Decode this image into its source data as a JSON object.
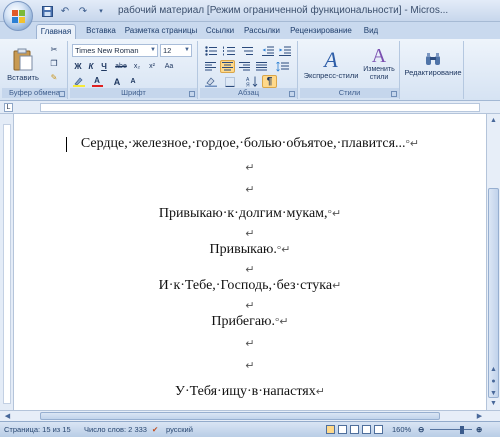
{
  "window": {
    "title": "рабочий материал [Режим ограниченной функциональности] - Micros..."
  },
  "icons": {
    "office": "office-orb",
    "save": "save-icon",
    "undo": "undo-icon",
    "redo": "redo-icon",
    "qat_menu": "dropdown-arrow-icon"
  },
  "tabs": [
    {
      "label": "Главная"
    },
    {
      "label": "Вставка"
    },
    {
      "label": "Разметка страницы"
    },
    {
      "label": "Ссылки"
    },
    {
      "label": "Рассылки"
    },
    {
      "label": "Рецензирование"
    },
    {
      "label": "Вид"
    }
  ],
  "ribbon": {
    "clipboard": {
      "label": "Буфер обмена",
      "paste_label": "Вставить"
    },
    "font": {
      "label": "Шрифт",
      "font_name": "Times New Roman",
      "font_size": "12",
      "bold": "Ж",
      "italic": "К",
      "underline": "Ч",
      "strike": "abe",
      "sub": "x₂",
      "sup": "x²",
      "grow": "A",
      "shrink": "A",
      "case": "Aa",
      "clear": "A"
    },
    "paragraph": {
      "label": "Абзац",
      "pilcrow": "¶"
    },
    "styles": {
      "label": "Стили",
      "express": "Экспресс-стили",
      "change": "Изменить стили"
    },
    "editing": {
      "label": "Редактирование"
    }
  },
  "document": {
    "lines": [
      "Сердце,·железное,·гордое,·болью·объятое,·плавится...",
      "",
      "",
      "Привыкаю·к·долгим·мукам,",
      "",
      "Привыкаю.",
      "",
      "И·к·Тебе,·Господь,·без·стука",
      "",
      "Прибегаю.",
      "",
      "",
      "У·Тебя·ищу·в·напастях"
    ],
    "trailing_marks": [
      "°↵",
      "↵",
      "↵",
      "°↵",
      "↵",
      "°↵",
      "↵",
      "↵",
      "↵",
      "°↵",
      "↵",
      "↵",
      "↵"
    ]
  },
  "status": {
    "page": "Страница: 15 из 15",
    "words": "Число слов: 2 333",
    "language": "русский",
    "zoom": "160%"
  },
  "colors": {
    "ribbon_bg": "#d6e3f3",
    "accent": "#15396e",
    "highlight": "#ffd98a"
  }
}
